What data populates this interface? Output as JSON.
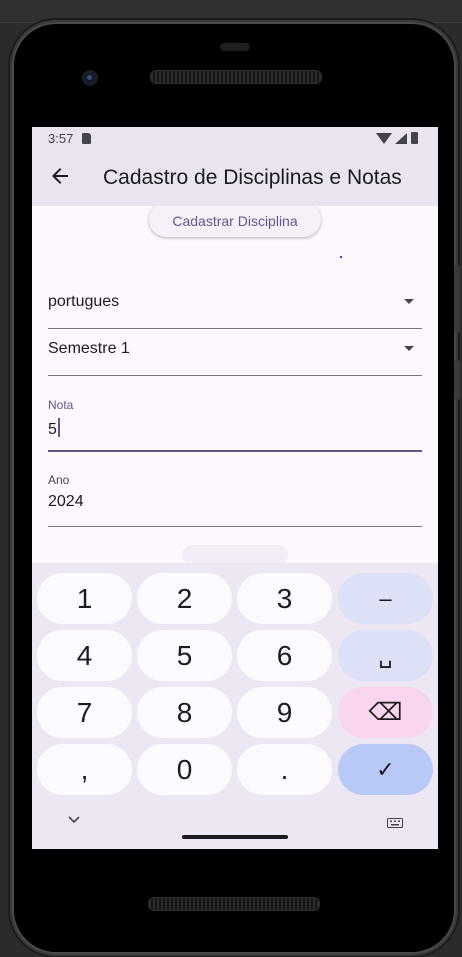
{
  "status": {
    "time": "3:57"
  },
  "appbar": {
    "title": "Cadastro de Disciplinas e Notas"
  },
  "form": {
    "register_button": "Cadastrar Disciplina",
    "subject_dropdown": {
      "value": "portugues"
    },
    "semester_dropdown": {
      "value": "Semestre 1"
    },
    "grade_field": {
      "label": "Nota",
      "value": "5"
    },
    "year_field": {
      "label": "Ano",
      "value": "2024"
    }
  },
  "keyboard": {
    "keys": [
      "1",
      "2",
      "3",
      "–",
      "4",
      "5",
      "6",
      "␣",
      "7",
      "8",
      "9",
      "⌫",
      ",",
      "0",
      ".",
      "✓"
    ]
  },
  "colors": {
    "accent": "#65558f",
    "appbar_bg": "#eae4f1",
    "surface": "#fdf7fe"
  }
}
